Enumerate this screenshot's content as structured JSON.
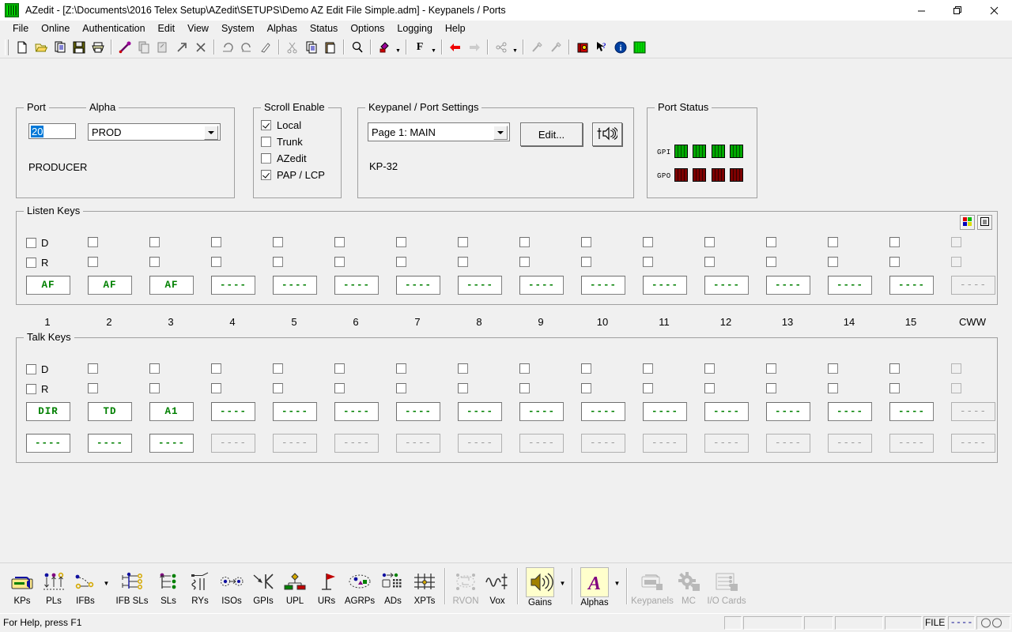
{
  "window": {
    "title": "AZedit - [Z:\\Documents\\2016 Telex Setup\\AZedit\\SETUPS\\Demo AZ Edit File Simple.adm] - Keypanels / Ports",
    "minimize_label": "─",
    "restore_label": "❐",
    "close_label": "✕"
  },
  "menubar": {
    "items": [
      {
        "label": "File"
      },
      {
        "label": "Online"
      },
      {
        "label": "Authentication"
      },
      {
        "label": "Edit"
      },
      {
        "label": "View"
      },
      {
        "label": "System"
      },
      {
        "label": "Alphas"
      },
      {
        "label": "Status"
      },
      {
        "label": "Options"
      },
      {
        "label": "Logging"
      },
      {
        "label": "Help"
      }
    ]
  },
  "toolbar": {
    "items": [
      {
        "name": "new-icon"
      },
      {
        "name": "open-icon"
      },
      {
        "name": "save-as-icon"
      },
      {
        "name": "save-icon"
      },
      {
        "name": "print-icon"
      },
      {
        "name": "separator"
      },
      {
        "name": "download-icon"
      },
      {
        "name": "copy-page-icon"
      },
      {
        "name": "paste-page-icon"
      },
      {
        "name": "send-icon"
      },
      {
        "name": "cancel-icon"
      },
      {
        "name": "separator"
      },
      {
        "name": "undo-icon"
      },
      {
        "name": "redo-icon"
      },
      {
        "name": "clear-icon"
      },
      {
        "name": "separator"
      },
      {
        "name": "cut-icon"
      },
      {
        "name": "copy-icon"
      },
      {
        "name": "paste-icon"
      },
      {
        "name": "separator"
      },
      {
        "name": "find-icon"
      },
      {
        "name": "separator"
      },
      {
        "name": "color-fill-icon"
      },
      {
        "name": "color-fill-dropdown"
      },
      {
        "name": "separator"
      },
      {
        "name": "font-icon"
      },
      {
        "name": "font-dropdown"
      },
      {
        "name": "separator"
      },
      {
        "name": "back-icon"
      },
      {
        "name": "forward-icon"
      },
      {
        "name": "separator"
      },
      {
        "name": "network-icon"
      },
      {
        "name": "network-dropdown"
      },
      {
        "name": "separator"
      },
      {
        "name": "pick-icon"
      },
      {
        "name": "apply-icon"
      },
      {
        "name": "separator"
      },
      {
        "name": "book-icon"
      },
      {
        "name": "help-cursor-icon"
      },
      {
        "name": "info-icon"
      },
      {
        "name": "grid-icon"
      }
    ]
  },
  "port_group": {
    "caption": "Port",
    "value": "20"
  },
  "alpha_group": {
    "caption": "Alpha",
    "value": "PROD",
    "description": "PRODUCER"
  },
  "scroll_enable": {
    "caption": "Scroll Enable",
    "options": [
      {
        "label": "Local",
        "checked": true
      },
      {
        "label": "Trunk",
        "checked": false
      },
      {
        "label": "AZedit",
        "checked": false
      },
      {
        "label": "PAP / LCP",
        "checked": true
      }
    ]
  },
  "keypanel_settings": {
    "caption": "Keypanel / Port Settings",
    "page_value": "Page 1: MAIN",
    "edit_label": "Edit...",
    "audio_button_icon": "speaker-fader-icon",
    "model": "KP-32"
  },
  "port_status": {
    "caption": "Port Status",
    "gpi_label": "GPI",
    "gpo_label": "GPO",
    "gpi_states": [
      true,
      true,
      true,
      true
    ],
    "gpo_states": [
      false,
      false,
      false,
      false
    ],
    "gpi_color": "#00a800",
    "gpo_color": "#7d0000"
  },
  "listen_keys": {
    "caption": "Listen Keys",
    "d_label": "D",
    "r_label": "R",
    "palette_button_icon": "color-palette-icon",
    "panel_button_icon": "panel-icon",
    "keys": [
      {
        "text": "AF",
        "disabled": false
      },
      {
        "text": "AF",
        "disabled": false
      },
      {
        "text": "AF",
        "disabled": false
      },
      {
        "text": "----",
        "disabled": false
      },
      {
        "text": "----",
        "disabled": false
      },
      {
        "text": "----",
        "disabled": false
      },
      {
        "text": "----",
        "disabled": false
      },
      {
        "text": "----",
        "disabled": false
      },
      {
        "text": "----",
        "disabled": false
      },
      {
        "text": "----",
        "disabled": false
      },
      {
        "text": "----",
        "disabled": false
      },
      {
        "text": "----",
        "disabled": false
      },
      {
        "text": "----",
        "disabled": false
      },
      {
        "text": "----",
        "disabled": false
      },
      {
        "text": "----",
        "disabled": false
      },
      {
        "text": "----",
        "disabled": true
      }
    ]
  },
  "key_numbers": [
    "1",
    "2",
    "3",
    "4",
    "5",
    "6",
    "7",
    "8",
    "9",
    "10",
    "11",
    "12",
    "13",
    "14",
    "15",
    "CWW"
  ],
  "talk_keys": {
    "caption": "Talk Keys",
    "d_label": "D",
    "r_label": "R",
    "row1": [
      {
        "text": "DIR",
        "disabled": false
      },
      {
        "text": "TD",
        "disabled": false
      },
      {
        "text": "A1",
        "disabled": false
      },
      {
        "text": "----",
        "disabled": false
      },
      {
        "text": "----",
        "disabled": false
      },
      {
        "text": "----",
        "disabled": false
      },
      {
        "text": "----",
        "disabled": false
      },
      {
        "text": "----",
        "disabled": false
      },
      {
        "text": "----",
        "disabled": false
      },
      {
        "text": "----",
        "disabled": false
      },
      {
        "text": "----",
        "disabled": false
      },
      {
        "text": "----",
        "disabled": false
      },
      {
        "text": "----",
        "disabled": false
      },
      {
        "text": "----",
        "disabled": false
      },
      {
        "text": "----",
        "disabled": false
      },
      {
        "text": "----",
        "disabled": true
      }
    ],
    "row2": [
      {
        "text": "----",
        "disabled": false
      },
      {
        "text": "----",
        "disabled": false
      },
      {
        "text": "----",
        "disabled": false
      },
      {
        "text": "----",
        "disabled": true
      },
      {
        "text": "----",
        "disabled": true
      },
      {
        "text": "----",
        "disabled": true
      },
      {
        "text": "----",
        "disabled": true
      },
      {
        "text": "----",
        "disabled": true
      },
      {
        "text": "----",
        "disabled": true
      },
      {
        "text": "----",
        "disabled": true
      },
      {
        "text": "----",
        "disabled": true
      },
      {
        "text": "----",
        "disabled": true
      },
      {
        "text": "----",
        "disabled": true
      },
      {
        "text": "----",
        "disabled": true
      },
      {
        "text": "----",
        "disabled": true
      },
      {
        "text": "----",
        "disabled": true
      }
    ]
  },
  "bottom_toolbar": {
    "items": [
      {
        "label": "KPs",
        "icon": "keypanel-icon",
        "disabled": false,
        "pressed": false,
        "dropdown": false
      },
      {
        "label": "PLs",
        "icon": "partyline-icon",
        "disabled": false,
        "pressed": false,
        "dropdown": false
      },
      {
        "label": "IFBs",
        "icon": "ifb-icon",
        "disabled": false,
        "pressed": false,
        "dropdown": true
      },
      {
        "label": "IFB SLs",
        "icon": "ifb-sl-icon",
        "disabled": false,
        "pressed": false,
        "dropdown": false
      },
      {
        "label": "SLs",
        "icon": "sl-icon",
        "disabled": false,
        "pressed": false,
        "dropdown": false
      },
      {
        "label": "RYs",
        "icon": "relay-icon",
        "disabled": false,
        "pressed": false,
        "dropdown": false
      },
      {
        "label": "ISOs",
        "icon": "iso-icon",
        "disabled": false,
        "pressed": false,
        "dropdown": false
      },
      {
        "label": "GPIs",
        "icon": "gpi-icon",
        "disabled": false,
        "pressed": false,
        "dropdown": false
      },
      {
        "label": "UPL",
        "icon": "upl-icon",
        "disabled": false,
        "pressed": false,
        "dropdown": false
      },
      {
        "label": "URs",
        "icon": "ur-icon",
        "disabled": false,
        "pressed": false,
        "dropdown": false
      },
      {
        "label": "AGRPs",
        "icon": "agrp-icon",
        "disabled": false,
        "pressed": false,
        "dropdown": false
      },
      {
        "label": "ADs",
        "icon": "ad-icon",
        "disabled": false,
        "pressed": false,
        "dropdown": false
      },
      {
        "label": "XPTs",
        "icon": "xpt-icon",
        "disabled": false,
        "pressed": false,
        "dropdown": false
      },
      {
        "label": "RVON",
        "icon": "rvon-icon",
        "disabled": true,
        "pressed": false,
        "dropdown": false
      },
      {
        "label": "Vox",
        "icon": "vox-icon",
        "disabled": false,
        "pressed": false,
        "dropdown": false
      },
      {
        "label": "Gains",
        "icon": "gain-icon",
        "disabled": false,
        "pressed": true,
        "dropdown": true
      },
      {
        "label": "Alphas",
        "icon": "alpha-icon",
        "disabled": false,
        "pressed": true,
        "dropdown": true
      },
      {
        "label": "Keypanels",
        "icon": "keypanels-icon",
        "disabled": true,
        "pressed": false,
        "dropdown": false
      },
      {
        "label": "MC",
        "icon": "mc-icon",
        "disabled": true,
        "pressed": false,
        "dropdown": false
      },
      {
        "label": "I/O Cards",
        "icon": "iocards-icon",
        "disabled": true,
        "pressed": false,
        "dropdown": false
      }
    ]
  },
  "statusbar": {
    "help_text": "For Help, press F1",
    "file_label": "FILE",
    "file_value": "----"
  }
}
